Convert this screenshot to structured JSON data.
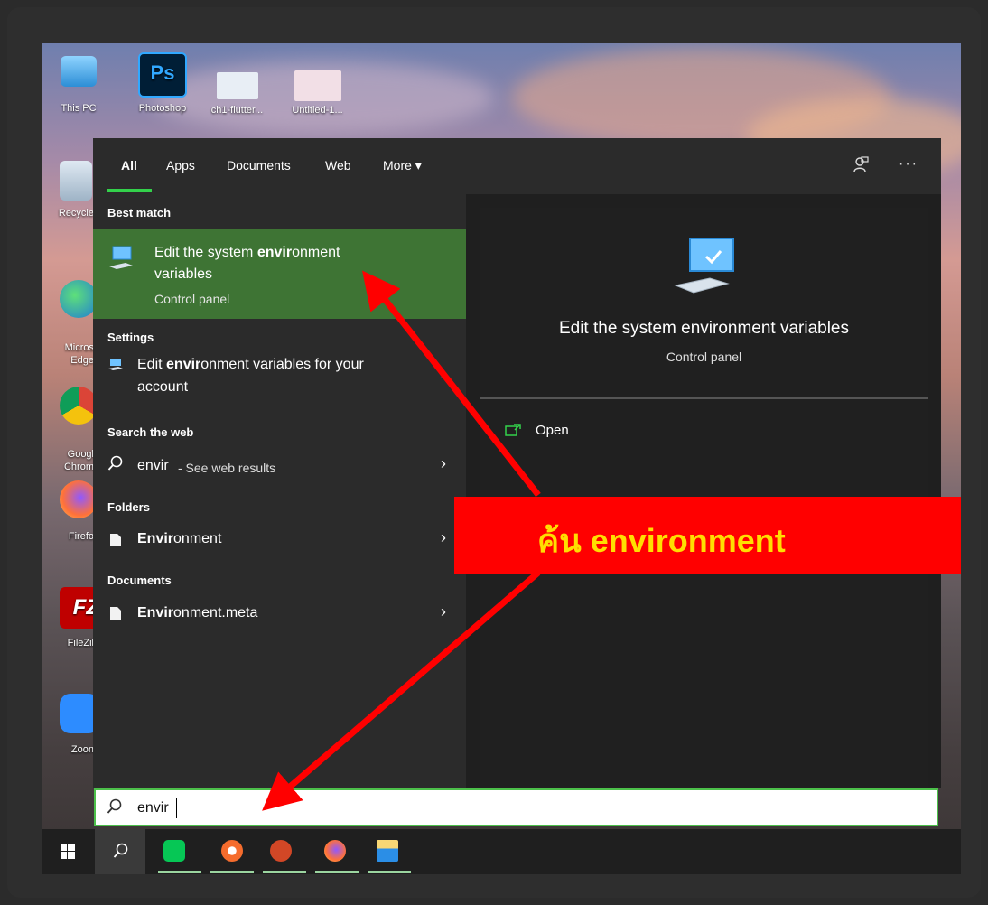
{
  "desktop": {
    "top_icons": [
      {
        "label": "This PC"
      },
      {
        "label": "Photoshop",
        "glyph": "Ps"
      },
      {
        "label": "ch1-flutter..."
      },
      {
        "label": "Untitled-1..."
      }
    ],
    "side_icons": [
      {
        "label": "Recycle"
      },
      {
        "label": "Micros\nEdge"
      },
      {
        "label": "Googl\nChrom"
      },
      {
        "label": "Firefo"
      },
      {
        "label": "FileZil",
        "glyph": "FZ"
      },
      {
        "label": "Zoon"
      }
    ]
  },
  "tabs": {
    "all": "All",
    "apps": "Apps",
    "documents": "Documents",
    "web": "Web",
    "more": "More ▾"
  },
  "toolbar_icons": [
    "feedback-icon",
    "more-options-icon"
  ],
  "toolbar": {
    "more_glyph": "···"
  },
  "left_pane": {
    "best_match": {
      "section": "Best match",
      "title_pre": "Edit the system ",
      "title_bold": "envir",
      "title_post": "onment",
      "title_line2": "variables",
      "subtitle": "Control panel"
    },
    "settings": {
      "section": "Settings",
      "text_pre": "Edit ",
      "text_bold": "envir",
      "text_post": "onment variables for your",
      "text_line2": "account"
    },
    "web": {
      "section": "Search the web",
      "query": "envir",
      "suffix": " - See web results"
    },
    "folders": {
      "section": "Folders",
      "bold": "Envir",
      "rest": "onment"
    },
    "documents": {
      "section": "Documents",
      "bold": "Envir",
      "rest": "onment.meta"
    },
    "chevron": "›"
  },
  "right_pane": {
    "title": "Edit the system environment variables",
    "subtitle": "Control panel",
    "open_label": "Open"
  },
  "search": {
    "value": "envir"
  },
  "taskbar_apps": [
    "windows-start",
    "search",
    "line",
    "origin",
    "powerpoint",
    "firefox",
    "file-explorer"
  ],
  "annotation": {
    "text": "ค้น environment",
    "color": "#ff0000",
    "text_color": "#ffde00"
  },
  "colors": {
    "best_match_bg": "#3e7434",
    "accent_green": "#33d14b",
    "pane_bg": "#2b2b2b"
  }
}
